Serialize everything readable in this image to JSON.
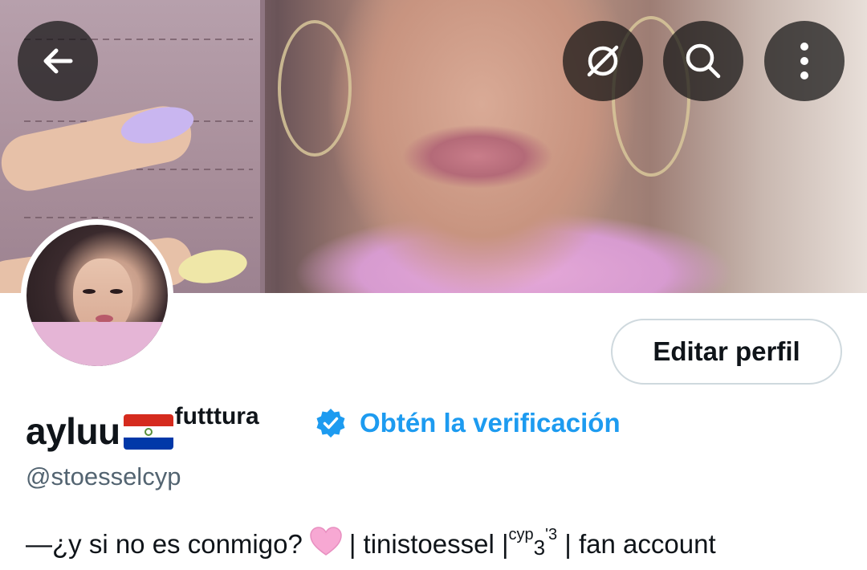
{
  "header": {
    "back_icon": "arrow-left-icon",
    "hide_icon": "eye-slash-icon",
    "search_icon": "search-icon",
    "more_icon": "more-vertical-icon"
  },
  "profile": {
    "edit_label": "Editar perfil",
    "display_name": "ayluu",
    "flag": "Paraguay flag",
    "name_suffix": "futttura",
    "verify_label": "Obtén la verificación",
    "handle": "@stoesselcyp",
    "bio_part1": "—¿y si no es conmigo?",
    "bio_part2": "| tinistoessel | ",
    "bio_sup1": "cyp",
    "bio_sub": "3",
    "bio_sup2": "'3",
    "bio_part3": " | fan account"
  },
  "colors": {
    "accent": "#1d9bf0",
    "text": "#0f1419",
    "muted": "#536471",
    "button_border": "#cfd9de"
  }
}
